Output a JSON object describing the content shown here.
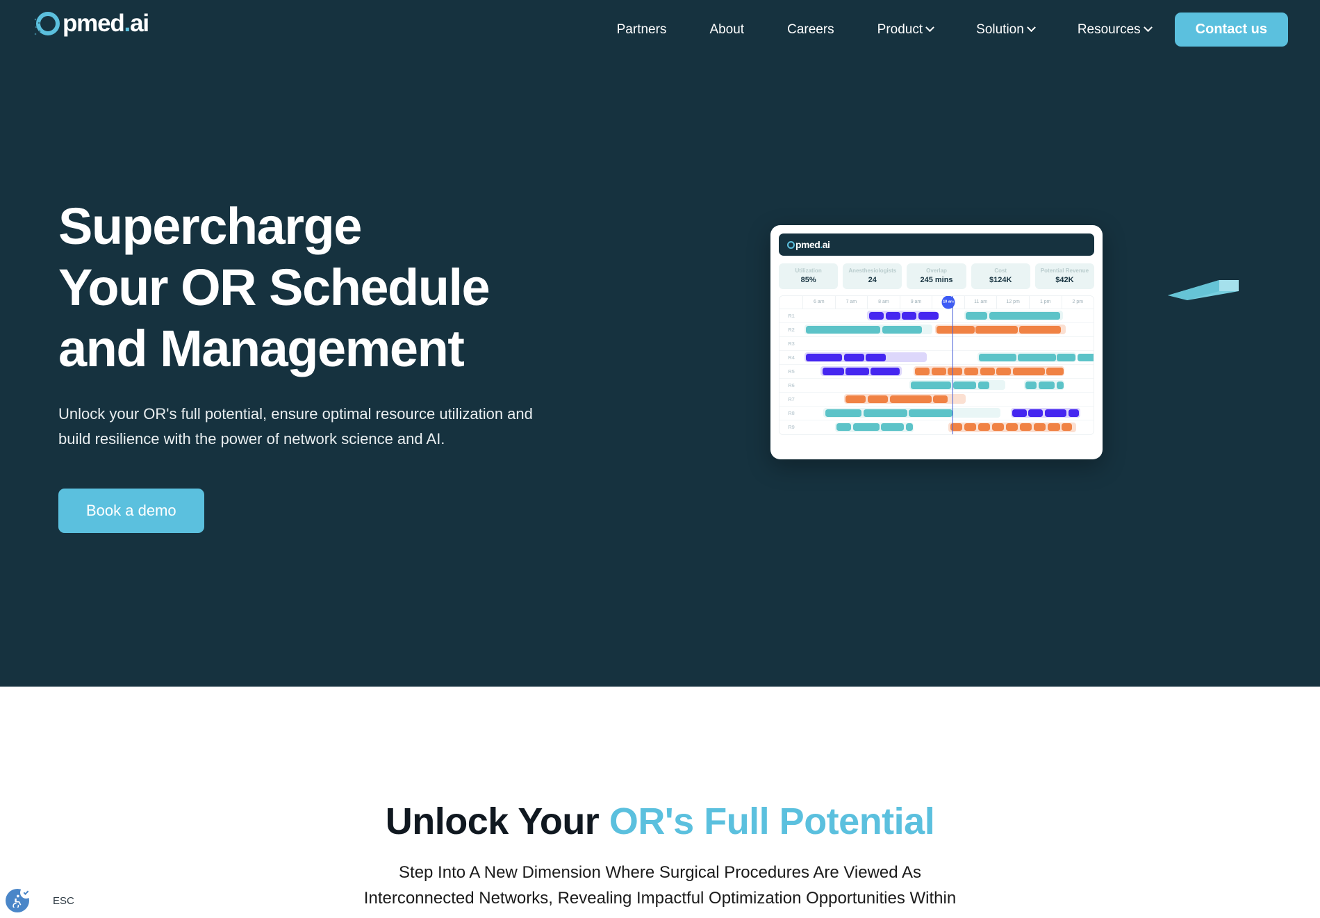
{
  "brand": {
    "name": "Opmed.ai",
    "mark": "logo-o-icon",
    "accent_color": "#5bc0de",
    "dark_color": "#16323f"
  },
  "nav": {
    "items": [
      {
        "label": "Partners",
        "has_dropdown": false
      },
      {
        "label": "About",
        "has_dropdown": false
      },
      {
        "label": "Careers",
        "has_dropdown": false
      },
      {
        "label": "Product",
        "has_dropdown": true
      },
      {
        "label": "Solution",
        "has_dropdown": true
      },
      {
        "label": "Resources",
        "has_dropdown": true
      }
    ],
    "cta": {
      "label": "Contact us"
    }
  },
  "hero": {
    "title_line1": "Supercharge",
    "title_line2": "Your OR Schedule",
    "title_line3": "and Management",
    "subtitle": "Unlock your OR's full potential, ensure optimal resource utilization and build resilience with the power of network science and AI.",
    "cta": {
      "label": "Book a demo"
    }
  },
  "dashboard": {
    "titlebar_brand": "Opmed.ai",
    "kpis": [
      {
        "label": "Utilization",
        "value": "85%"
      },
      {
        "label": "Anesthesiologists",
        "value": "24"
      },
      {
        "label": "Overlap",
        "value": "245 mins"
      },
      {
        "label": "Cost",
        "value": "$124K"
      },
      {
        "label": "Potential Revenue",
        "value": "$42K"
      }
    ],
    "time_axis": [
      "6 am",
      "7 am",
      "8 am",
      "9 am",
      "10 am",
      "11 am",
      "12 pm",
      "1 pm",
      "2 pm"
    ],
    "current_time": "10 am",
    "current_time_index": 4,
    "rows": [
      "R1",
      "R2",
      "R3",
      "R4",
      "R5",
      "R6",
      "R7",
      "R8",
      "R9"
    ],
    "legend_colors": {
      "teal": "#5cc3c8",
      "orange": "#f08244",
      "purple": "#4526f0"
    }
  },
  "section": {
    "title_plain": "Unlock Your ",
    "title_accent": "OR's Full Potential",
    "subtitle_line1": "Step Into A New Dimension Where Surgical Procedures Are Viewed As",
    "subtitle_line2": "Interconnected Networks, Revealing Impactful Optimization Opportunities Within"
  },
  "accessibility": {
    "icon": "accessibility-icon",
    "esc_label": "ESC"
  }
}
